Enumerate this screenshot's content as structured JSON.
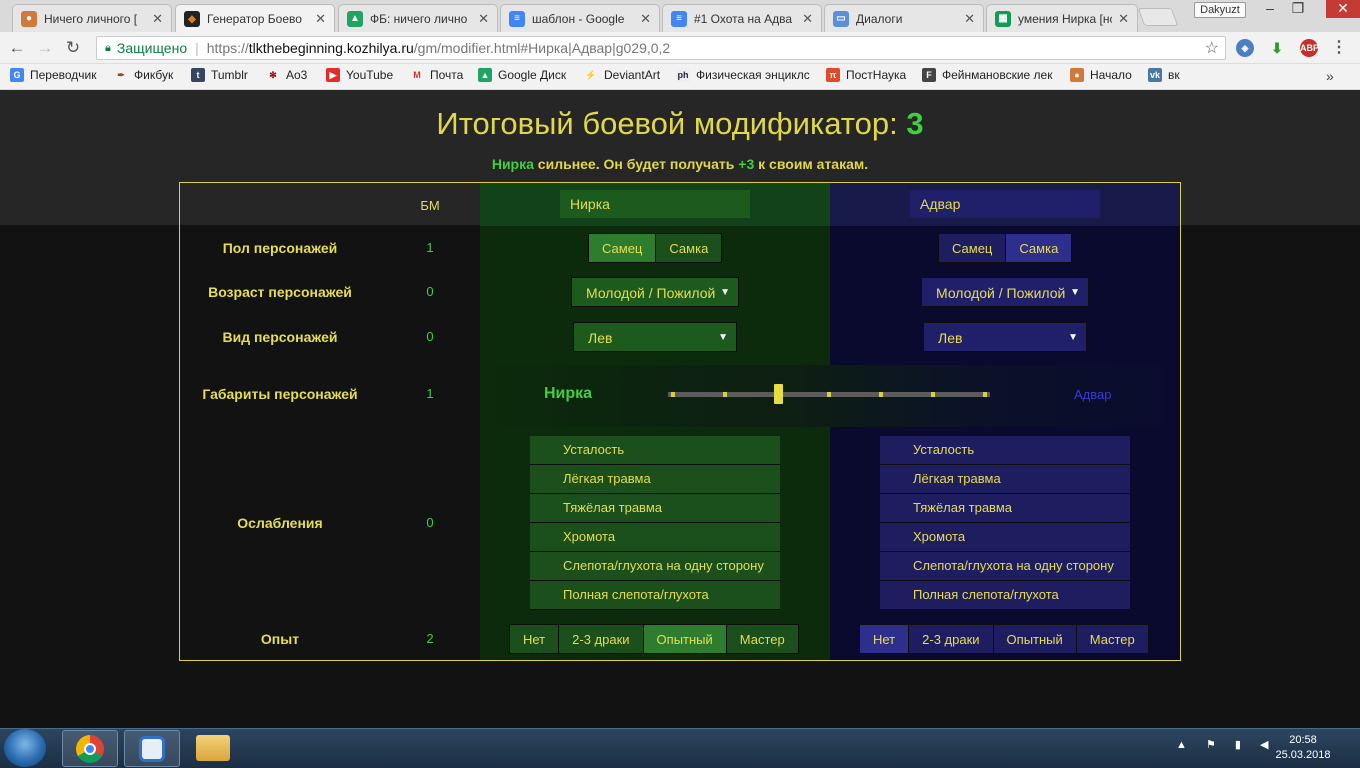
{
  "browser": {
    "tabs": [
      {
        "title": "Ничего личного [",
        "icon": "fox-avatar-icon",
        "active": false
      },
      {
        "title": "Генератор Боево",
        "icon": "kozhilya-favicon-icon",
        "active": true
      },
      {
        "title": "ФБ: ничего лично",
        "icon": "google-drive-icon",
        "active": false
      },
      {
        "title": "шаблон - Google",
        "icon": "google-docs-icon",
        "active": false
      },
      {
        "title": "#1 Охота на Адва",
        "icon": "google-docs-icon",
        "active": false
      },
      {
        "title": "Диалоги",
        "icon": "chat-icon",
        "active": false
      },
      {
        "title": "умения Нирка [нс",
        "icon": "google-sheets-icon",
        "active": false
      }
    ],
    "user_badge": "Dakyuzt",
    "secure_label": "Защищено",
    "url_proto": "https://",
    "url_host": "tlkthebeginning.kozhilya.ru",
    "url_path": "/gm/modifier.html#Нирка|Адвар|g029,0,2",
    "bookmarks": [
      {
        "label": "Переводчик",
        "icon": "translate-icon"
      },
      {
        "label": "Фикбук",
        "icon": "feather-icon"
      },
      {
        "label": "Tumblr",
        "icon": "tumblr-icon"
      },
      {
        "label": "Ao3",
        "icon": "ao3-icon"
      },
      {
        "label": "YouTube",
        "icon": "youtube-icon"
      },
      {
        "label": "Почта",
        "icon": "gmail-icon"
      },
      {
        "label": "Google Диск",
        "icon": "google-drive-icon"
      },
      {
        "label": "DeviantArt",
        "icon": "deviantart-icon"
      },
      {
        "label": "Физическая энциклс",
        "icon": "physics-icon"
      },
      {
        "label": "ПостНаука",
        "icon": "postnauka-icon"
      },
      {
        "label": "Фейнмановские лек",
        "icon": "feynman-icon"
      },
      {
        "label": "Начало",
        "icon": "fox-avatar-icon"
      },
      {
        "label": "вк",
        "icon": "vk-icon"
      }
    ]
  },
  "page": {
    "title_prefix": "Итоговый боевой модификатор:",
    "title_value": "3",
    "summary_name": "Нирка",
    "summary_text": "сильнее. Он будет получать",
    "summary_bonus": "+3",
    "summary_tail": "к своим атакам.",
    "bm_header": "БМ",
    "char1_name": "Нирка",
    "char2_name": "Адвар",
    "rows": {
      "sex": {
        "label": "Пол персонажей",
        "bm": "1",
        "options": [
          "Самец",
          "Самка"
        ],
        "char1": "Самец",
        "char2": "Самка"
      },
      "age": {
        "label": "Возраст персонажей",
        "bm": "0",
        "char1": "Молодой / Пожилой",
        "char2": "Молодой / Пожилой"
      },
      "species": {
        "label": "Вид персонажей",
        "bm": "0",
        "char1": "Лев",
        "char2": "Лев"
      },
      "size": {
        "label": "Габариты персонажей",
        "bm": "1",
        "left": "Нирка",
        "right": "Адвар",
        "slider_position_fraction": 0.33
      },
      "weakness": {
        "label": "Ослабления",
        "bm": "0",
        "items": [
          "Усталость",
          "Лёгкая травма",
          "Тяжёлая травма",
          "Хромота",
          "Слепота/глухота на одну сторону",
          "Полная слепота/глухота"
        ]
      },
      "experience": {
        "label": "Опыт",
        "bm": "2",
        "options": [
          "Нет",
          "2-3 драки",
          "Опытный",
          "Мастер"
        ],
        "char1": "Опытный",
        "char2": "Нет"
      }
    }
  },
  "taskbar": {
    "time": "20:58",
    "date": "25.03.2018"
  },
  "colors": {
    "accent_yellow": "#e6dd52",
    "accent_green": "#3fcf3f",
    "char1_panel": "#0c2a0c",
    "char2_panel": "#0a0a2e",
    "border": "#d7cf45"
  }
}
